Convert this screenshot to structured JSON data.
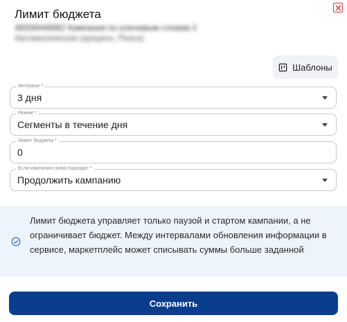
{
  "dialog": {
    "title": "Лимит бюджета",
    "subtitle_line1": "46558446882 Кампания по ключевым словам 2",
    "subtitle_line2": "Автоматическая (аукцион, Поиск)"
  },
  "templates_button": {
    "label": "Шаблоны",
    "icon": "template-icon"
  },
  "fields": {
    "interval": {
      "label": "Интервал *",
      "value": "3 дня"
    },
    "mode": {
      "label": "Режим *",
      "value": "Сегменты в течение дня"
    },
    "budget_limit": {
      "label": "Лимит бюджета *",
      "value": "0"
    },
    "on_fit": {
      "label": "Если кампания снова подходит *",
      "value": "Продолжить кампанию"
    }
  },
  "info": {
    "icon": "check-circle-icon",
    "text": "Лимит бюджета управляет только паузой и стартом кампании, а не ограничивает бюджет. Между интервалами обновления информации в сервисе, маркетплейс может списывать суммы больше заданной"
  },
  "save_button": {
    "label": "Сохранить"
  },
  "colors": {
    "primary": "#0b3d8f",
    "close": "#d93a3a",
    "info_bg": "#eef4fb",
    "info_icon": "#2e63c7"
  }
}
